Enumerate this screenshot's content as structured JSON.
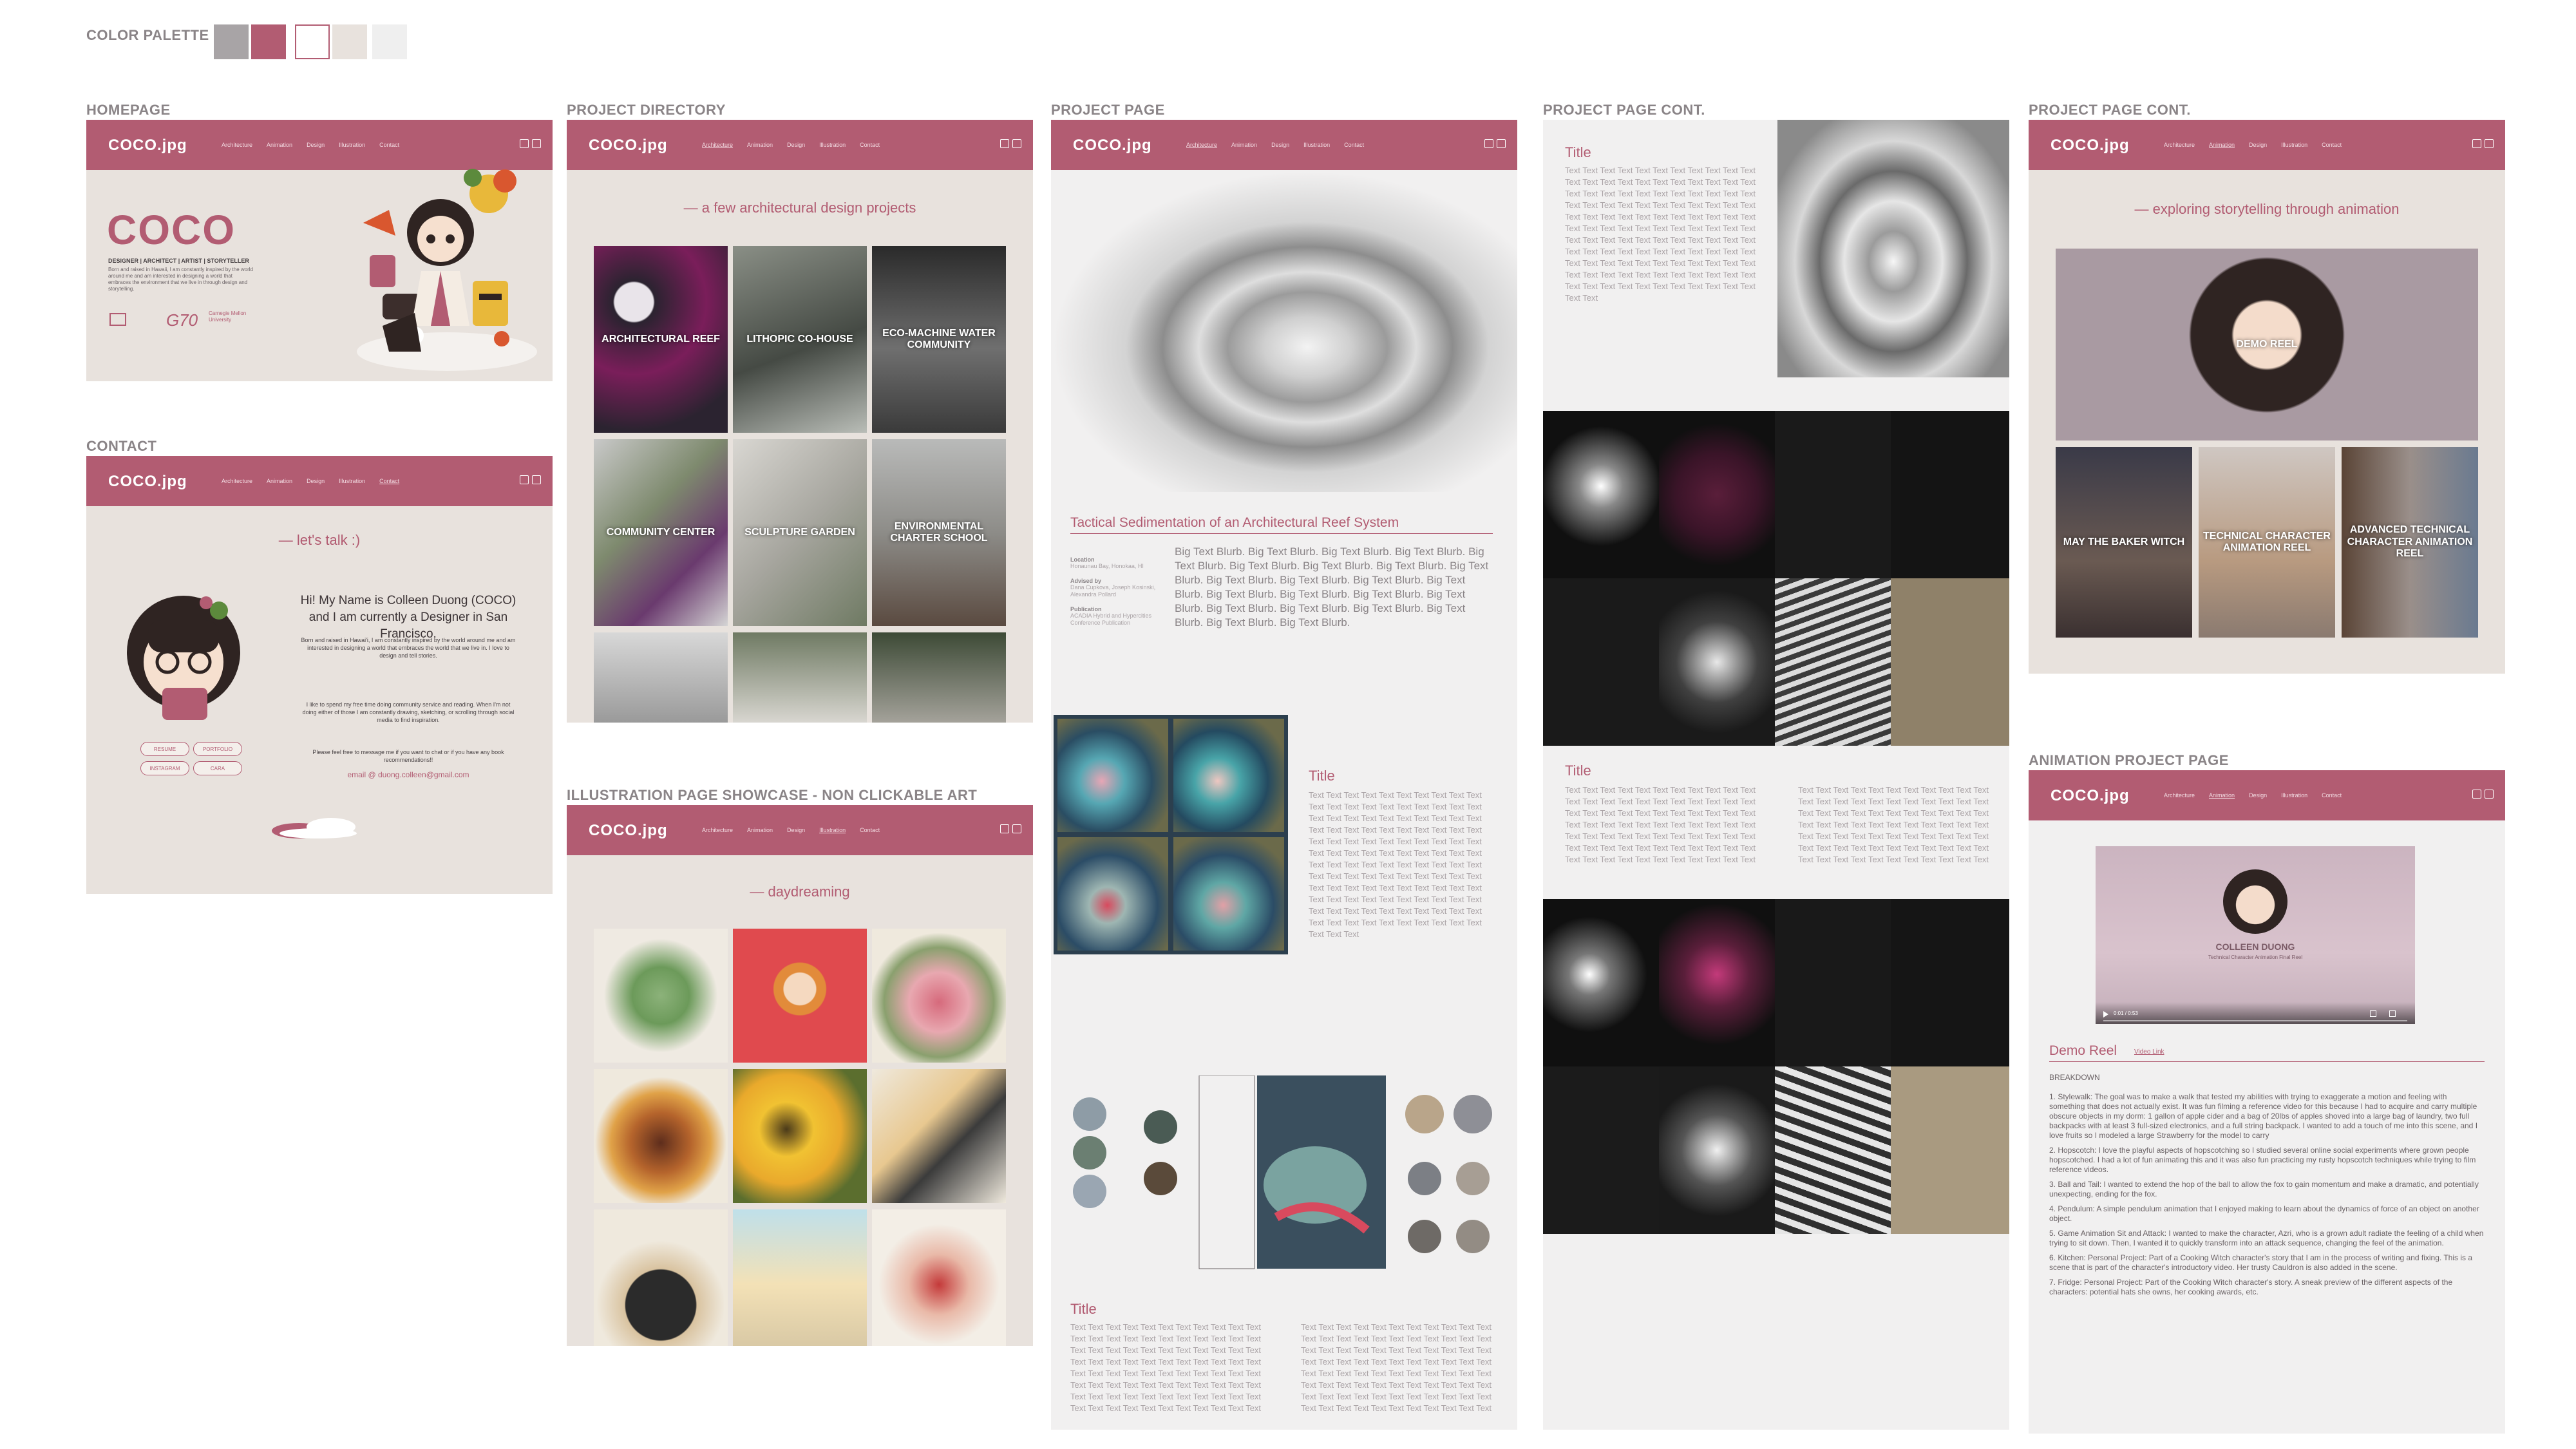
{
  "palette": {
    "label": "COLOR PALETTE",
    "colors": [
      "#a8a4a6",
      "#b25c72",
      "#ffffff",
      "#e8e2dd",
      "#efefef"
    ],
    "outline": "#b25c72"
  },
  "sections": {
    "homepage": "HOMEPAGE",
    "contact": "CONTACT",
    "project_directory": "PROJECT DIRECTORY",
    "illustration": "ILLUSTRATION PAGE SHOWCASE - NON CLICKABLE ART",
    "project_page": "PROJECT PAGE",
    "project_page_cont1": "PROJECT PAGE CONT.",
    "project_page_cont2": "PROJECT PAGE CONT.",
    "animation_project_page": "ANIMATION PROJECT PAGE"
  },
  "nav": {
    "logo": "COCO.jpg",
    "links": [
      "Architecture",
      "Animation",
      "Design",
      "Illustration",
      "Contact"
    ]
  },
  "homepage": {
    "title": "COCO",
    "subtitle": "DESIGNER | ARCHITECT | ARTIST | STORYTELLER",
    "blurb": "Born and raised in Hawaii, I am constantly inspired by the world around me and am interested in designing a world that embraces the environment that we live in through design and storytelling.",
    "logos": [
      "G70",
      "Carnegie Mellon University"
    ]
  },
  "contact": {
    "tagline": "— let's talk :)",
    "heading": "Hi! My Name is Colleen Duong (COCO) and I am currently a Designer in San Francisco.",
    "body1": "Born and raised in Hawai'i, I am constantly inspired by the world around me and am interested in designing a world that embraces the world that we live in. I love to design and tell stories.",
    "body2": "I like to spend my free time doing community service and reading. When I'm not doing either of those I am constantly drawing, sketching, or scrolling through social media to find inspiration.",
    "body3": "Please feel free to message me if you want to chat or if you have any book recommendations!!",
    "email": "email @ duong.colleen@gmail.com",
    "buttons": [
      "RESUME",
      "PORTFOLIO",
      "INSTAGRAM",
      "CARA"
    ]
  },
  "directory": {
    "tagline": "— a few architectural design projects",
    "tiles": [
      "ARCHITECTURAL REEF",
      "LITHOPIC CO-HOUSE",
      "ECO-MACHINE WATER COMMUNITY",
      "COMMUNITY CENTER",
      "SCULPTURE GARDEN",
      "ENVIRONMENTAL CHARTER SCHOOL"
    ]
  },
  "illustration": {
    "tagline": "— daydreaming"
  },
  "project": {
    "title": "Tactical Sedimentation of an Architectural Reef System",
    "meta": [
      {
        "k": "Location",
        "v": "Honaunau Bay, Honokaa, HI"
      },
      {
        "k": "Advised by",
        "v": "Dana Cupkova, Joseph Kosinski, Alexandra Pollard"
      },
      {
        "k": "Publication",
        "v": "ACADIA Hybrid and Hypercities Conference Publication"
      }
    ],
    "blurb": "Big Text Blurb. Big Text Blurb. Big Text Blurb. Big Text Blurb. Big Text Blurb. Big Text Blurb. Big Text Blurb. Big Text Blurb. Big Text Blurb. Big Text Blurb. Big Text Blurb. Big Text Blurb. Big Text Blurb. Big Text Blurb. Big Text Blurb. Big Text Blurb. Big Text Blurb. Big Text Blurb. Big Text Blurb. Big Text Blurb. Big Text Blurb. Big Text Blurb. Big Text Blurb.",
    "title2": "Title",
    "title3": "Title",
    "filler": "Text Text Text Text Text Text Text Text Text Text Text Text Text Text Text Text Text Text Text Text Text Text Text Text Text Text Text Text Text Text Text Text Text Text Text Text Text Text Text Text Text Text Text Text Text Text Text Text Text Text Text Text Text Text Text Text Text Text Text Text Text Text Text Text Text Text Text Text Text Text Text Text Text Text Text Text Text Text Text Text Text Text Text Text Text Text Text Text Text Text Text Text Text Text Text Text Text Text Text Text Text Text Text Text Text Text Text Text Text Text Text Text Text Text Text Text Text Text Text Text Text Text Text"
  },
  "cont1": {
    "title_a": "Title",
    "title_b": "Title"
  },
  "cont2": {
    "tagline": "— exploring storytelling through animation",
    "tiles": [
      "DEMO REEL",
      "MAY THE BAKER WITCH",
      "TECHNICAL CHARACTER ANIMATION REEL",
      "ADVANCED TECHNICAL CHARACTER ANIMATION REEL"
    ]
  },
  "animation": {
    "video_name": "COLLEEN DUONG",
    "video_sub": "Technical Character Animation Final Reel",
    "video_time": "0:01 / 0:53",
    "title": "Demo Reel",
    "link": "Video Link",
    "breakdown": "BREAKDOWN",
    "items": [
      "1. Stylewalk: The goal was to make a walk that tested my abilities with trying to exaggerate a motion and feeling with something that does not actually exist. It was fun filming a reference video for this because I had to acquire and carry multiple obscure objects in my dorm: 1 gallon of apple cider and a bag of 20lbs of apples shoved into a large bag of laundry, two full backpacks with at least 3 full-sized electronics, and a full string backpack. I wanted to add a touch of me into this scene, and I love fruits so I modeled a large Strawberry for the model to carry",
      "2. Hopscotch: I love the playful aspects of hopscotching so I studied several online social experiments where grown people hopscotched. I had a lot of fun animating this and it was also fun practicing my rusty hopscotch techniques while trying to film reference videos.",
      "3. Ball and Tail: I wanted to extend the hop of the ball to allow the fox to gain momentum and make a dramatic, and potentially unexpecting, ending for the fox.",
      "4. Pendulum: A simple pendulum animation that I enjoyed making to learn about the dynamics of force of an object on another object.",
      "5. Game Animation Sit and Attack: I wanted to make the character, Azri, who is a grown adult radiate the feeling of a child when trying to sit down. Then, I wanted it to quickly transform into an attack sequence, changing the feel of the animation.",
      "6. Kitchen: Personal Project: Part of a Cooking Witch character's story that I am in the process of writing and fixing. This is a scene that is part of the character's introductory video. Her trusty Cauldron is also added in the scene.",
      "7. Fridge: Personal Project: Part of the Cooking Witch character's story. A sneak preview of the different aspects of the characters: potential hats she owns, her cooking awards, etc."
    ]
  }
}
